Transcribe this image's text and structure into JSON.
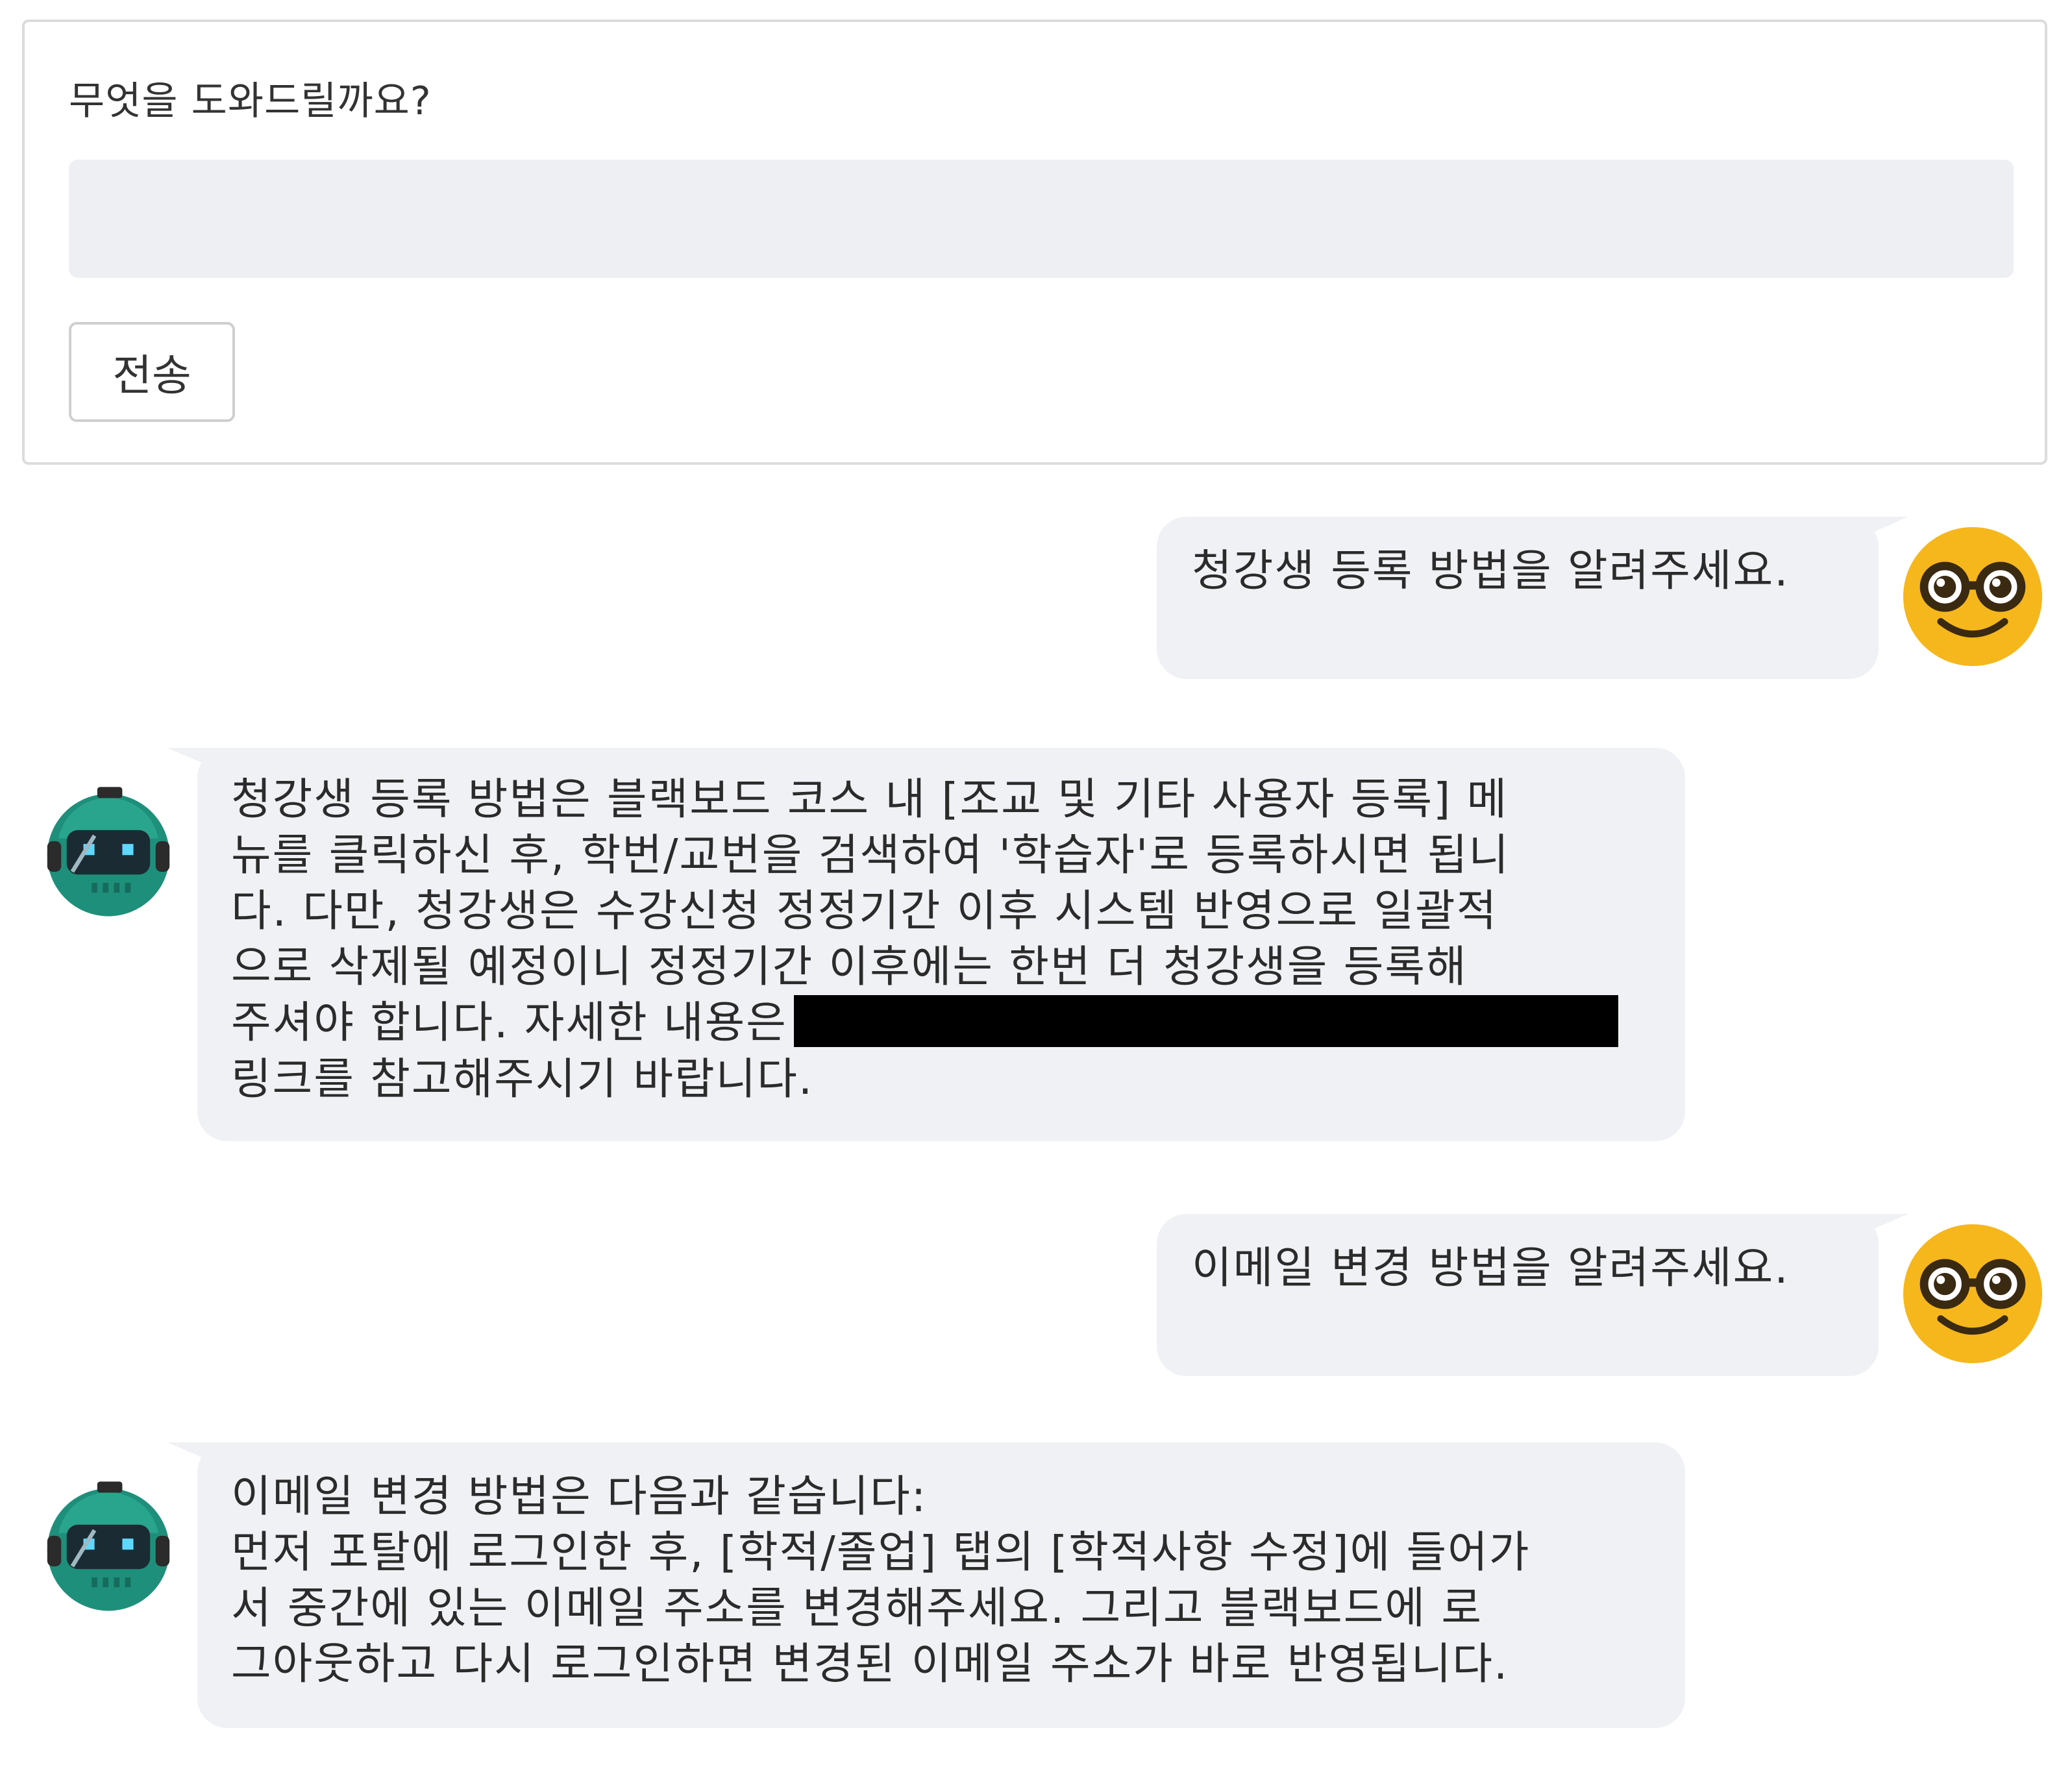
{
  "form": {
    "label": "무엇을 도와드릴까요?",
    "input_value": "",
    "input_placeholder": "",
    "send_label": "전송"
  },
  "colors": {
    "bubble_bg": "#f0f1f4",
    "user_avatar": "#f6b71c",
    "bot_avatar": "#1e8f7a",
    "redaction": "#000000"
  },
  "messages": [
    {
      "role": "user",
      "avatar_icon": "nerd-face-icon",
      "lines": [
        "청강생 등록 방법을 알려주세요."
      ]
    },
    {
      "role": "bot",
      "avatar_icon": "robot-icon",
      "lines": [
        "청강생 등록 방법은 블랙보드 코스 내 [조교 및 기타 사용자 등록] 메",
        "뉴를 클릭하신 후, 학번/교번을 검색하여 '학습자'로 등록하시면 됩니",
        "다. 다만, 청강생은 수강신청 정정기간 이후 시스템 반영으로 일괄적",
        "으로 삭제될 예정이니 정정기간 이후에는 한번 더 청강생을 등록해",
        "주셔야 합니다. 자세한 내용은",
        "링크를 참고해주시기 바랍니다."
      ]
    },
    {
      "role": "user",
      "avatar_icon": "nerd-face-icon",
      "lines": [
        "이메일 변경 방법을 알려주세요."
      ]
    },
    {
      "role": "bot",
      "avatar_icon": "robot-icon",
      "lines": [
        "이메일 변경 방법은 다음과 같습니다:",
        "먼저 포탈에 로그인한 후, [학적/졸업] 탭의 [학적사항 수정]에 들어가",
        "서 중간에 있는 이메일 주소를 변경해주세요. 그리고 블랙보드에 로",
        "그아웃하고 다시 로그인하면 변경된 이메일 주소가 바로 반영됩니다."
      ]
    }
  ]
}
